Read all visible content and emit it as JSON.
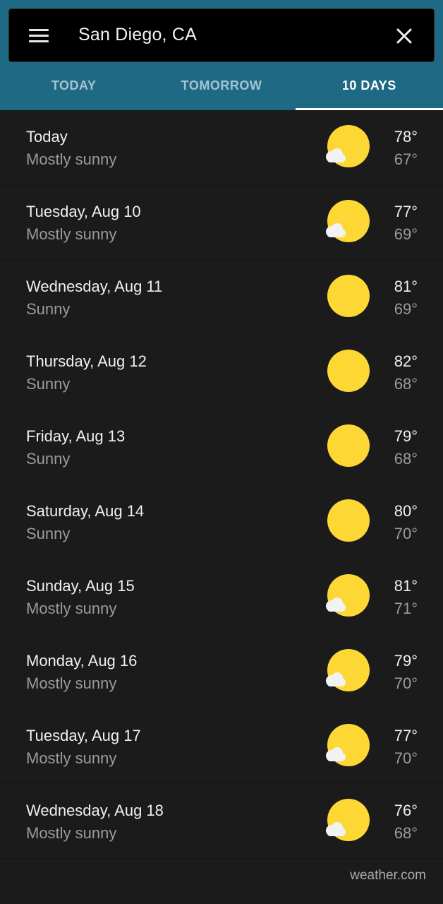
{
  "search": {
    "value": "San Diego, CA"
  },
  "tabs": [
    {
      "label": "TODAY",
      "active": false
    },
    {
      "label": "TOMORROW",
      "active": false
    },
    {
      "label": "10 DAYS",
      "active": true
    }
  ],
  "forecast": [
    {
      "day": "Today",
      "condition": "Mostly sunny",
      "high": "78°",
      "low": "67°",
      "icon": "mostly-sunny-icon"
    },
    {
      "day": "Tuesday, Aug 10",
      "condition": "Mostly sunny",
      "high": "77°",
      "low": "69°",
      "icon": "mostly-sunny-icon"
    },
    {
      "day": "Wednesday, Aug 11",
      "condition": "Sunny",
      "high": "81°",
      "low": "69°",
      "icon": "sunny-icon"
    },
    {
      "day": "Thursday, Aug 12",
      "condition": "Sunny",
      "high": "82°",
      "low": "68°",
      "icon": "sunny-icon"
    },
    {
      "day": "Friday, Aug 13",
      "condition": "Sunny",
      "high": "79°",
      "low": "68°",
      "icon": "sunny-icon"
    },
    {
      "day": "Saturday, Aug 14",
      "condition": "Sunny",
      "high": "80°",
      "low": "70°",
      "icon": "sunny-icon"
    },
    {
      "day": "Sunday, Aug 15",
      "condition": "Mostly sunny",
      "high": "81°",
      "low": "71°",
      "icon": "mostly-sunny-icon"
    },
    {
      "day": "Monday, Aug 16",
      "condition": "Mostly sunny",
      "high": "79°",
      "low": "70°",
      "icon": "mostly-sunny-icon"
    },
    {
      "day": "Tuesday, Aug 17",
      "condition": "Mostly sunny",
      "high": "77°",
      "low": "70°",
      "icon": "mostly-sunny-icon"
    },
    {
      "day": "Wednesday, Aug 18",
      "condition": "Mostly sunny",
      "high": "76°",
      "low": "68°",
      "icon": "mostly-sunny-icon"
    }
  ],
  "footer": {
    "source": "weather.com"
  },
  "colors": {
    "header": "#1e6a85",
    "background": "#1b1b1b",
    "sun": "#fdd835",
    "cloud": "#f2f2f2"
  }
}
